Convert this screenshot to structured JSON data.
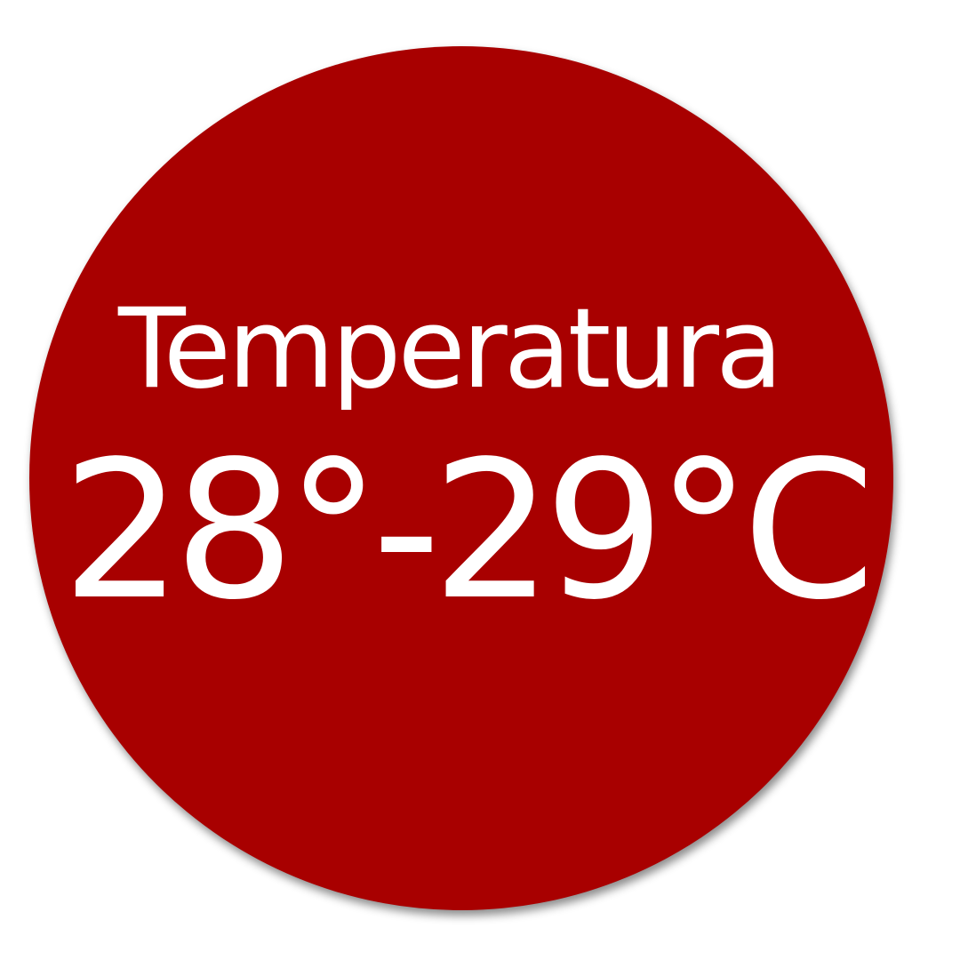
{
  "badge": {
    "label": "Temperatura",
    "value": "28°-29°C"
  },
  "colors": {
    "badge_fill": "#a80000",
    "text": "#ffffff",
    "background": "#ffffff"
  }
}
